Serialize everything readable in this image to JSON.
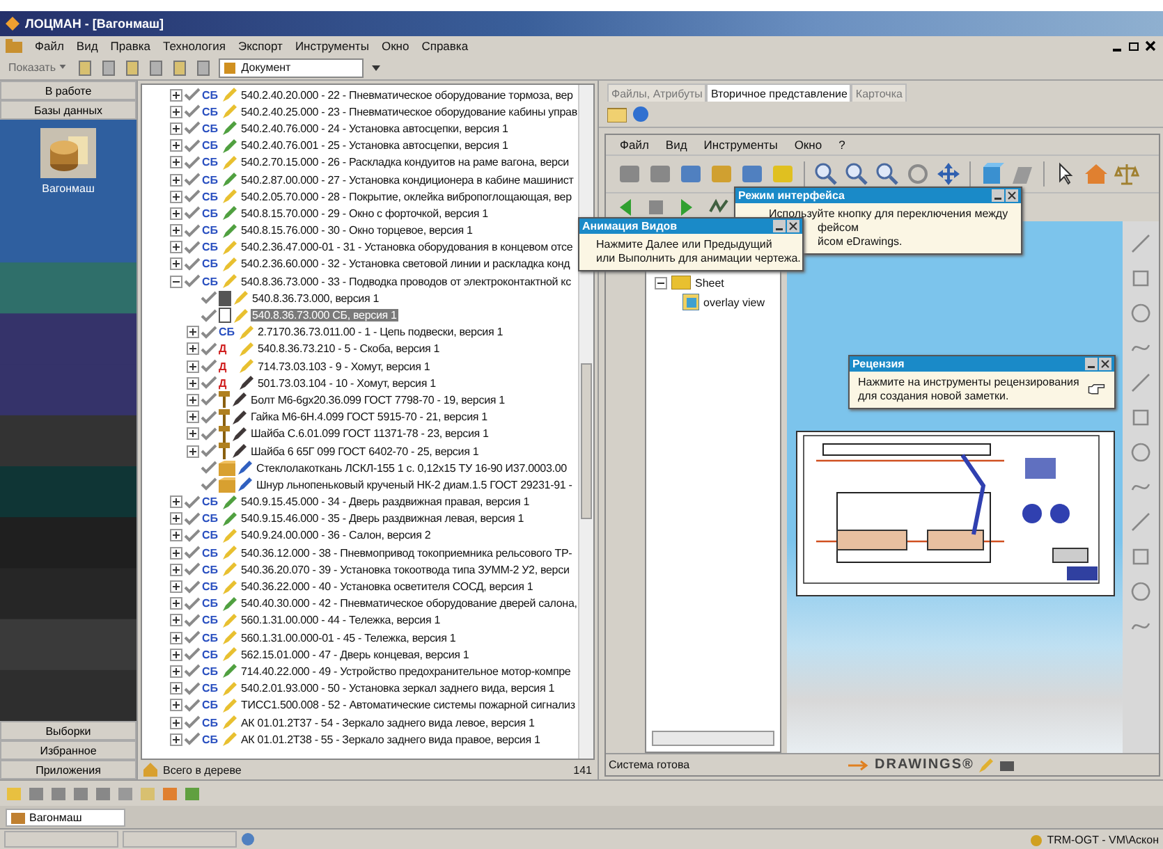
{
  "window": {
    "title": "ЛОЦМАН - [Вагонмаш]"
  },
  "menu": [
    "Файл",
    "Вид",
    "Правка",
    "Технология",
    "Экспорт",
    "Инструменты",
    "Окно",
    "Справка"
  ],
  "toolbar": {
    "show_button": "Показать",
    "document_combo": "Документ"
  },
  "sidebar": {
    "top_buttons": [
      "В работе",
      "Базы данных"
    ],
    "database": {
      "label": "Вагонмаш"
    },
    "bottom_buttons": [
      "Выборки",
      "Избранное",
      "Приложения"
    ]
  },
  "tree": {
    "rows": [
      {
        "kind": "assembly",
        "badge": "СБ",
        "color": "#e8c030",
        "text": "540.2.40.20.000 - 22 - Пневматическое оборудование тормоза, вер",
        "expanded": false,
        "selected": false
      },
      {
        "kind": "assembly",
        "badge": "СБ",
        "color": "#e8c030",
        "text": "540.2.40.25.000 - 23 - Пневматическое оборудование кабины управ",
        "expanded": false,
        "selected": false
      },
      {
        "kind": "assembly",
        "badge": "СБ",
        "color": "#50a040",
        "text": "540.2.40.76.000 - 24 - Установка автосцепки, версия 1",
        "expanded": false,
        "selected": false
      },
      {
        "kind": "assembly",
        "badge": "СБ",
        "color": "#50a040",
        "text": "540.2.40.76.001 - 25 - Установка автосцепки, версия 1",
        "expanded": false,
        "selected": false
      },
      {
        "kind": "assembly",
        "badge": "СБ",
        "color": "#e8c030",
        "text": "540.2.70.15.000 - 26 - Раскладка кондуитов на раме вагона, верси",
        "expanded": false,
        "selected": false
      },
      {
        "kind": "assembly",
        "badge": "СБ",
        "color": "#50a040",
        "text": "540.2.87.00.000 - 27 - Установка кондиционера в кабине машинист",
        "expanded": false,
        "selected": false
      },
      {
        "kind": "assembly",
        "badge": "СБ",
        "color": "#e8c030",
        "text": "540.2.05.70.000 - 28 - Покрытие, оклейка вибропоглощающая, вер",
        "expanded": false,
        "selected": false
      },
      {
        "kind": "assembly",
        "badge": "СБ",
        "color": "#50a040",
        "text": "540.8.15.70.000 - 29 - Окно с форточкой, версия 1",
        "expanded": false,
        "selected": false
      },
      {
        "kind": "assembly",
        "badge": "СБ",
        "color": "#50a040",
        "text": "540.8.15.76.000 - 30 - Окно торцевое, версия 1",
        "expanded": false,
        "selected": false
      },
      {
        "kind": "assembly",
        "badge": "СБ",
        "color": "#e8c030",
        "text": "540.2.36.47.000-01 - 31 - Установка оборудования в концевом отсе",
        "expanded": false,
        "selected": false
      },
      {
        "kind": "assembly",
        "badge": "СБ",
        "color": "#e8c030",
        "text": "540.2.36.60.000 - 32 - Установка световой линии и раскладка конд",
        "expanded": false,
        "selected": false
      },
      {
        "kind": "assembly",
        "badge": "СБ",
        "color": "#e8c030",
        "text": "540.8.36.73.000 - 33 - Подводка проводов от электроконтактной кс",
        "expanded": true,
        "selected": false,
        "children": [
          {
            "kind": "document",
            "color": "#e8c030",
            "text": "540.8.36.73.000, версия 1",
            "selected": false
          },
          {
            "kind": "document",
            "color": "#e8c030",
            "text": "540.8.36.73.000 СБ, версия 1",
            "selected": true
          },
          {
            "kind": "assembly",
            "badge": "СБ",
            "color": "#e8c030",
            "text": "2.7170.36.73.011.00 - 1 - Цепь подвески, версия 1",
            "expanded": false,
            "selected": false
          },
          {
            "kind": "part",
            "badge": "Д",
            "color": "#e8c030",
            "text": "540.8.36.73.210 - 5 - Скоба, версия 1",
            "expanded": false,
            "selected": false
          },
          {
            "kind": "part",
            "badge": "Д",
            "color": "#e8c030",
            "text": "714.73.03.103 - 9 - Хомут, версия 1",
            "expanded": false,
            "selected": false
          },
          {
            "kind": "part",
            "badge": "Д",
            "color": "#403838",
            "text": "501.73.03.104 - 10 - Хомут, версия 1",
            "expanded": false,
            "selected": false
          },
          {
            "kind": "standard",
            "color": "#403838",
            "text": "Болт М6-6gх20.36.099 ГОСТ 7798-70 - 19, версия 1",
            "expanded": false,
            "selected": false
          },
          {
            "kind": "standard",
            "color": "#403838",
            "text": "Гайка М6-6Н.4.099 ГОСТ 5915-70 - 21, версия 1",
            "expanded": false,
            "selected": false
          },
          {
            "kind": "standard",
            "color": "#403838",
            "text": "Шайба С.6.01.099 ГОСТ 11371-78 - 23, версия 1",
            "expanded": false,
            "selected": false
          },
          {
            "kind": "standard",
            "color": "#403838",
            "text": "Шайба 6 65Г 099 ГОСТ 6402-70 - 25, версия 1",
            "expanded": false,
            "selected": false
          },
          {
            "kind": "material",
            "color": "#3060c0",
            "text": "Стеклолакоткань ЛСКЛ-155 1 с. 0,12х15 ТУ 16-90 И37.0003.00",
            "selected": false
          },
          {
            "kind": "material",
            "color": "#3060c0",
            "text": "Шнур льнопеньковый крученый НК-2 диам.1.5 ГОСТ 29231-91 -",
            "selected": false
          }
        ]
      },
      {
        "kind": "assembly",
        "badge": "СБ",
        "color": "#50a040",
        "text": "540.9.15.45.000 - 34 - Дверь раздвижная правая, версия 1",
        "expanded": false,
        "selected": false
      },
      {
        "kind": "assembly",
        "badge": "СБ",
        "color": "#50a040",
        "text": "540.9.15.46.000 - 35 - Дверь раздвижная левая, версия 1",
        "expanded": false,
        "selected": false
      },
      {
        "kind": "assembly",
        "badge": "СБ",
        "color": "#e8c030",
        "text": "540.9.24.00.000 - 36 - Салон, версия 2",
        "expanded": false,
        "selected": false
      },
      {
        "kind": "assembly",
        "badge": "СБ",
        "color": "#e8c030",
        "text": "540.36.12.000 - 38 - Пневмопривод токоприемника рельсового ТР-",
        "expanded": false,
        "selected": false
      },
      {
        "kind": "assembly",
        "badge": "СБ",
        "color": "#e8c030",
        "text": "540.36.20.070 - 39 - Установка токоотвода типа ЗУММ-2 У2, верси",
        "expanded": false,
        "selected": false
      },
      {
        "kind": "assembly",
        "badge": "СБ",
        "color": "#e8c030",
        "text": "540.36.22.000 - 40 - Установка осветителя СОСД, версия 1",
        "expanded": false,
        "selected": false
      },
      {
        "kind": "assembly",
        "badge": "СБ",
        "color": "#50a040",
        "text": "540.40.30.000 - 42 - Пневматическое оборудование дверей салона,",
        "expanded": false,
        "selected": false
      },
      {
        "kind": "assembly",
        "badge": "СБ",
        "color": "#e8c030",
        "text": "560.1.31.00.000 - 44 - Тележка, версия 1",
        "expanded": false,
        "selected": false
      },
      {
        "kind": "assembly",
        "badge": "СБ",
        "color": "#e8c030",
        "text": "560.1.31.00.000-01 - 45 - Тележка, версия 1",
        "expanded": false,
        "selected": false
      },
      {
        "kind": "assembly",
        "badge": "СБ",
        "color": "#e8c030",
        "text": "562.15.01.000 - 47 - Дверь концевая, версия 1",
        "expanded": false,
        "selected": false
      },
      {
        "kind": "assembly",
        "badge": "СБ",
        "color": "#50a040",
        "text": "714.40.22.000 - 49 - Устройство предохранительное мотор-компре",
        "expanded": false,
        "selected": false
      },
      {
        "kind": "assembly",
        "badge": "СБ",
        "color": "#e8c030",
        "text": "540.2.01.93.000 - 50 - Установка зеркал заднего вида, версия 1",
        "expanded": false,
        "selected": false
      },
      {
        "kind": "assembly",
        "badge": "СБ",
        "color": "#e8c030",
        "text": "ТИСС1.500.008 - 52 - Автоматические системы пожарной сигнализ",
        "expanded": false,
        "selected": false
      },
      {
        "kind": "assembly",
        "badge": "СБ",
        "color": "#e8c030",
        "text": "АК 01.01.2Т37 - 54 - Зеркало заднего вида левое, версия 1",
        "expanded": false,
        "selected": false
      },
      {
        "kind": "assembly",
        "badge": "СБ",
        "color": "#e8c030",
        "text": "АК 01.01.2Т38 - 55 - Зеркало заднего вида правое, версия 1",
        "expanded": false,
        "selected": false
      }
    ],
    "footer": {
      "label": "Всего в дереве",
      "count": "141"
    }
  },
  "viewer": {
    "tabs": [
      {
        "label": "Файлы, Атрибуты",
        "selected": false
      },
      {
        "label": "Вторичное представление",
        "selected": true
      },
      {
        "label": "Карточка",
        "selected": false
      }
    ],
    "menu": [
      "Файл",
      "Вид",
      "Инструменты",
      "Окно",
      "?"
    ],
    "sheet_tree": {
      "label": "Sheet",
      "expanded": true,
      "children": [
        {
          "label": "overlay view"
        }
      ]
    },
    "popups": [
      {
        "title": "Режим интерфейса",
        "lines": [
          "Используйте кнопку для переключения между",
          "фейсом",
          "йсом eDrawings."
        ]
      },
      {
        "title": "Анимация Видов",
        "lines": [
          "Нажмите Далее или Предыдущий",
          "или Выполнить для анимации чертежа."
        ]
      },
      {
        "title": "Рецензия",
        "lines": [
          "Нажмите на инструменты рецензирования",
          "для создания новой заметки."
        ]
      }
    ],
    "status": "Система готова",
    "brand": "DRAWINGS®"
  },
  "bottom_tab": "Вагонмаш",
  "status_bar": {
    "user": "TRM-OGT - VM\\Аскон"
  }
}
